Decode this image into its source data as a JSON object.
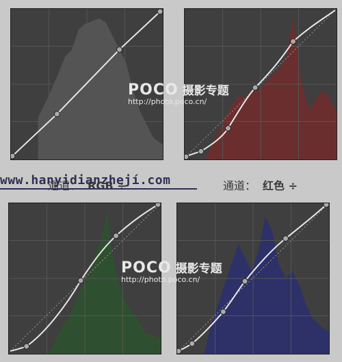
{
  "channels": [
    {
      "name": "rgb-curve",
      "label": "通道：",
      "value": "RGB ÷",
      "histogram_color": "#5a5a5a"
    },
    {
      "name": "red-curve",
      "label": "通道：",
      "value": "红色 ÷",
      "histogram_color": "#7a2e2e"
    },
    {
      "name": "green-curve",
      "histogram_color": "#345a30"
    },
    {
      "name": "blue-curve",
      "histogram_color": "#2f3478"
    }
  ],
  "watermark": {
    "site": "www.hanyidianzhejí.com",
    "brand": "POCO",
    "brand_cn": "摄影专题",
    "url": "http://photo.poco.cn/"
  },
  "colors": {
    "panel_bg": "#3f3f3f",
    "grid": "#555555",
    "curve": "#e8e8e8",
    "page_bg": "#c9c9c9"
  }
}
